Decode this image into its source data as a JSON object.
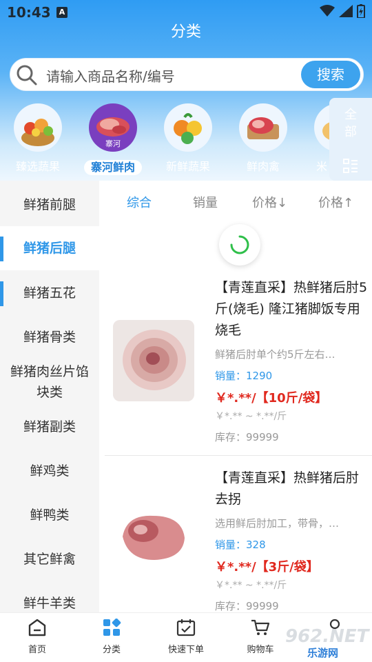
{
  "status": {
    "time": "10:43",
    "indicator": "A"
  },
  "page": {
    "title": "分类"
  },
  "search": {
    "placeholder": "请输入商品名称/编号",
    "button": "搜索"
  },
  "categories": [
    {
      "label": "臻选蔬果",
      "active": false
    },
    {
      "label": "寨河鲜肉",
      "badge": "寨河",
      "active": true
    },
    {
      "label": "新鲜蔬果",
      "active": false
    },
    {
      "label": "鲜肉禽",
      "active": false
    },
    {
      "label": "米",
      "active": false
    }
  ],
  "all_button": {
    "line1": "全",
    "line2": "部"
  },
  "sidebar": {
    "items": [
      {
        "label": "鲜猪前腿"
      },
      {
        "label": "鲜猪后腿"
      },
      {
        "label": "鲜猪五花"
      },
      {
        "label": "鲜猪骨类"
      },
      {
        "label": "鲜猪肉丝片馅块类"
      },
      {
        "label": "鲜猪副类"
      },
      {
        "label": "鲜鸡类"
      },
      {
        "label": "鲜鸭类"
      },
      {
        "label": "其它鲜禽"
      },
      {
        "label": "鲜牛羊类"
      }
    ],
    "active_index": 1
  },
  "sort": {
    "items": [
      {
        "label": "综合"
      },
      {
        "label": "销量"
      },
      {
        "label": "价格↓"
      },
      {
        "label": "价格↑"
      }
    ]
  },
  "products": [
    {
      "name": "【青莲直采】热鲜猪后肘5斤(烧毛) 隆江猪脚饭专用烧毛",
      "desc": "鲜猪后肘单个约5斤左右…",
      "sales": "销量：1290",
      "price": "￥*.**/【10斤/袋】",
      "range": "￥*.** ~ *.**/斤",
      "stock": "库存：99999"
    },
    {
      "name": "【青莲直采】热鲜猪后肘去拐",
      "desc": "选用鲜后肘加工，带骨，…",
      "sales": "销量：328",
      "price": "￥*.**/【3斤/袋】",
      "range": "￥*.** ~ *.**/斤",
      "stock": "库存：99999"
    }
  ],
  "tabbar": {
    "items": [
      {
        "label": "首页",
        "icon": "home-icon"
      },
      {
        "label": "分类",
        "icon": "category-icon"
      },
      {
        "label": "快速下单",
        "icon": "quick-order-icon"
      },
      {
        "label": "购物车",
        "icon": "cart-icon"
      }
    ],
    "active_index": 1
  },
  "watermark": {
    "main": "962.NET",
    "sub": "乐游网"
  },
  "colors": {
    "accent": "#2f97e8",
    "price": "#e0281e",
    "header_top": "#2f9cf3"
  }
}
